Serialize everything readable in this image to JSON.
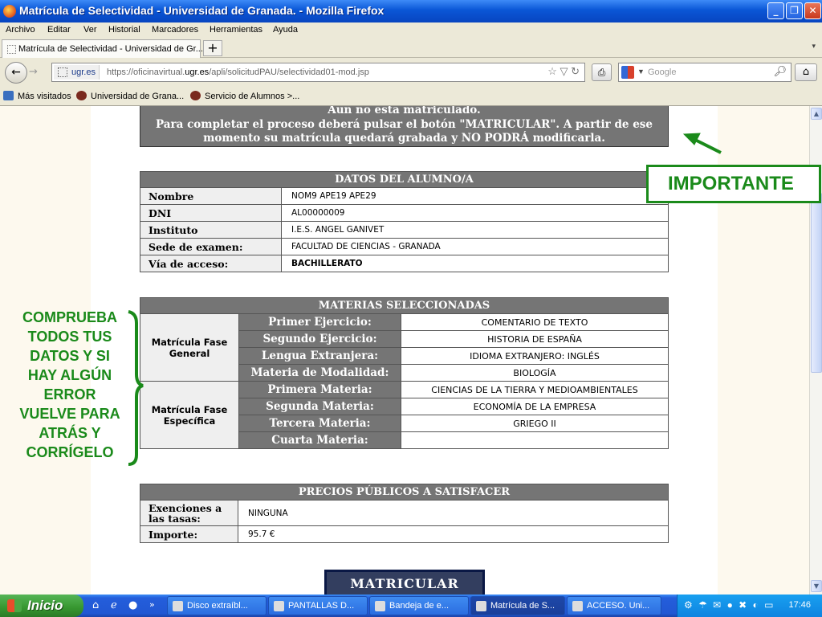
{
  "window": {
    "title": "Matrícula de Selectividad - Universidad de Granada. - Mozilla Firefox",
    "minimize": "_",
    "restore": "❐",
    "close": "✕"
  },
  "menu": [
    "Archivo",
    "Editar",
    "Ver",
    "Historial",
    "Marcadores",
    "Herramientas",
    "Ayuda"
  ],
  "tabs": [
    {
      "label": "Matrícula de Selectividad - Universidad de Gr..."
    }
  ],
  "new_tab": "+",
  "nav": {
    "site_label": "ugr.es",
    "url_prefix": "https://oficinavirtual.",
    "url_domain": "ugr.es",
    "url_path": "/apli/solicitudPAU/selectividad01-mod.jsp",
    "search_placeholder": "Google"
  },
  "bookmarks": [
    "Más visitados",
    "Universidad de Grana...",
    "Servicio de Alumnos >..."
  ],
  "page": {
    "notice_line1": "Aún no está matriculado.",
    "notice_line2": "Para completar el proceso deberá pulsar el botón \"MATRICULAR\". A partir de ese",
    "notice_line3": "momento su matrícula quedará grabada y NO PODRÁ modificarla.",
    "student": {
      "heading": "DATOS DEL ALUMNO/A",
      "rows": [
        {
          "label": "Nombre",
          "value": "NOM9 APE19 APE29"
        },
        {
          "label": "DNI",
          "value": "AL00000009"
        },
        {
          "label": "Instituto",
          "value": "I.E.S. ANGEL GANIVET"
        },
        {
          "label": "Sede de examen:",
          "value": "FACULTAD DE CIENCIAS - GRANADA"
        },
        {
          "label": "Vía de acceso:",
          "value": "BACHILLERATO"
        }
      ]
    },
    "subjects": {
      "heading": "MATERIAS SELECCIONADAS",
      "general_label": "Matrícula Fase General",
      "general": [
        {
          "label": "Primer Ejercicio:",
          "value": "COMENTARIO DE TEXTO"
        },
        {
          "label": "Segundo Ejercicio:",
          "value": "HISTORIA DE ESPAÑA"
        },
        {
          "label": "Lengua Extranjera:",
          "value": "IDIOMA EXTRANJERO: INGLÉS"
        },
        {
          "label": "Materia de Modalidad:",
          "value": "BIOLOGÍA"
        }
      ],
      "specific_label": "Matrícula Fase Específica",
      "specific": [
        {
          "label": "Primera Materia:",
          "value": "CIENCIAS DE LA TIERRA Y MEDIOAMBIENTALES"
        },
        {
          "label": "Segunda Materia:",
          "value": "ECONOMÍA DE LA EMPRESA"
        },
        {
          "label": "Tercera Materia:",
          "value": "GRIEGO II"
        },
        {
          "label": "Cuarta Materia:",
          "value": ""
        }
      ]
    },
    "prices": {
      "heading": "PRECIOS PÚBLICOS A SATISFACER",
      "rows": [
        {
          "label": "Exenciones a las tasas:",
          "value": "NINGUNA"
        },
        {
          "label": "Importe:",
          "value": "95.7 €"
        }
      ]
    },
    "submit_label": "MATRICULAR"
  },
  "annotations": {
    "important": "IMPORTANTE",
    "check_lines": [
      "COMPRUEBA",
      "TODOS TUS",
      "DATOS Y SI",
      "HAY ALGÚN",
      "ERROR",
      "VUELVE PARA",
      "ATRÁS Y",
      "CORRÍGELO"
    ],
    "color": "#1a8a1a"
  },
  "taskbar": {
    "start": "Inicio",
    "items": [
      "Disco extraíbl...",
      "PANTALLAS D...",
      "Bandeja de e...",
      "Matrícula de S...",
      "ACCESO.  Uni..."
    ],
    "clock": "17:46"
  }
}
